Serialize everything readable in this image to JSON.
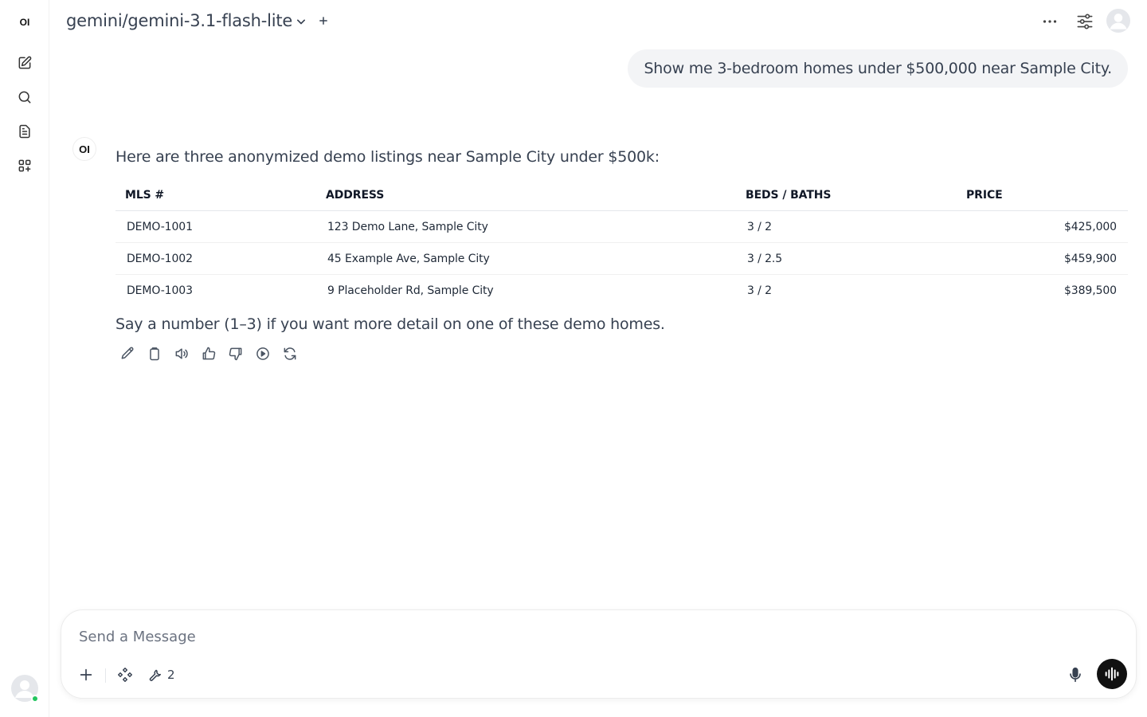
{
  "sidebar": {
    "logo": "OI",
    "items": [
      {
        "icon": "new-chat-icon"
      },
      {
        "icon": "search-icon"
      },
      {
        "icon": "notes-icon"
      },
      {
        "icon": "workspace-icon"
      }
    ]
  },
  "header": {
    "model": "gemini/gemini-3.1-flash-lite"
  },
  "chat": {
    "user_message": "Show me 3-bedroom homes under $500,000 near Sample City.",
    "assistant_logo": "OI",
    "intro": "Here are three anonymized demo listings near Sample City under $500k:",
    "table": {
      "headers": [
        "MLS #",
        "ADDRESS",
        "BEDS / BATHS",
        "PRICE"
      ],
      "rows": [
        [
          "DEMO-1001",
          "123 Demo Lane, Sample City",
          "3 / 2",
          "$425,000"
        ],
        [
          "DEMO-1002",
          "45 Example Ave, Sample City",
          "3 / 2.5",
          "$459,900"
        ],
        [
          "DEMO-1003",
          "9 Placeholder Rd, Sample City",
          "3 / 2",
          "$389,500"
        ]
      ]
    },
    "outro": "Say a number (1–3) if you want more detail on one of these demo homes."
  },
  "composer": {
    "placeholder": "Send a Message",
    "tools_count": "2"
  },
  "colors": {
    "user_bubble": "#f3f4f6",
    "online": "#22c55e",
    "voice_button": "#111111"
  }
}
